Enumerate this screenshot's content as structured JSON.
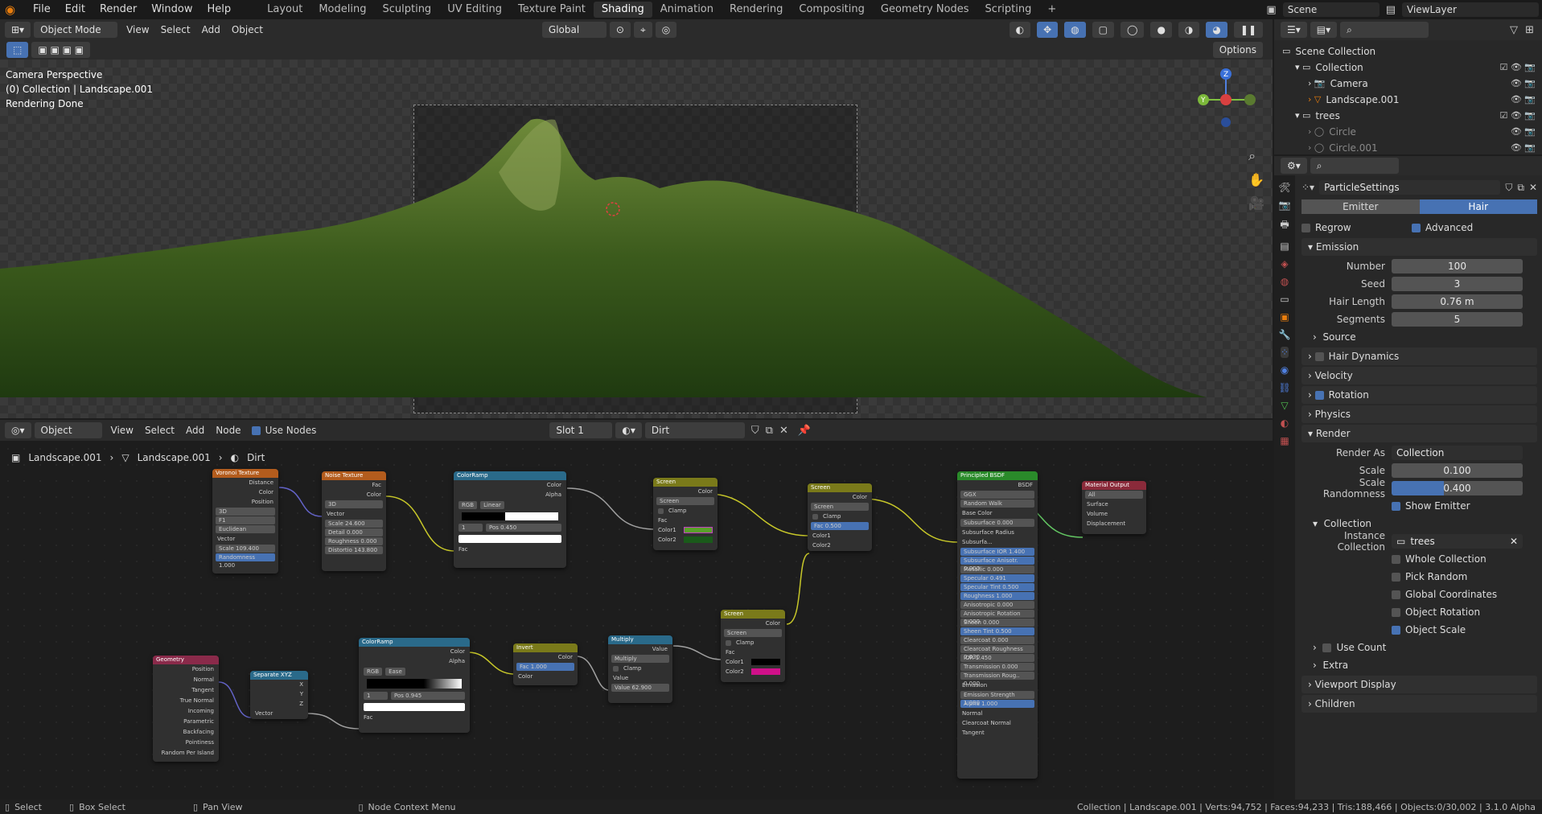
{
  "topbar": {
    "menus": [
      "File",
      "Edit",
      "Render",
      "Window",
      "Help"
    ],
    "workspaces": [
      "Layout",
      "Modeling",
      "Sculpting",
      "UV Editing",
      "Texture Paint",
      "Shading",
      "Animation",
      "Rendering",
      "Compositing",
      "Geometry Nodes",
      "Scripting"
    ],
    "active_workspace": "Shading",
    "scene": "Scene",
    "view_layer": "ViewLayer"
  },
  "viewport": {
    "mode": "Object Mode",
    "menus": [
      "View",
      "Select",
      "Add",
      "Object"
    ],
    "transform": "Global",
    "options": "Options",
    "info": [
      "Camera Perspective",
      "(0) Collection | Landscape.001",
      "Rendering Done"
    ]
  },
  "node_editor": {
    "type": "Object",
    "menus": [
      "View",
      "Select",
      "Add",
      "Node"
    ],
    "use_nodes": "Use Nodes",
    "slot": "Slot 1",
    "material": "Dirt",
    "breadcrumb": [
      "Landscape.001",
      "Landscape.001",
      "Dirt"
    ],
    "nodes": {
      "voronoi": {
        "title": "Voronoi Texture",
        "out": [
          "Distance",
          "Color",
          "Position"
        ],
        "dim": "3D",
        "feature": "F1",
        "metric": "Euclidean",
        "in": "Vector",
        "scale": "Scale   109.400",
        "random": "Randomness  1.000"
      },
      "noise": {
        "title": "Noise Texture",
        "out": [
          "Fac",
          "Color"
        ],
        "dim": "3D",
        "in": "Vector",
        "scale": "Scale   24.600",
        "detail": "Detail   0.000",
        "rough": "Roughness   0.000",
        "distort": "Distortio 143.800"
      },
      "ramp1": {
        "title": "ColorRamp",
        "out": [
          "Color",
          "Alpha"
        ],
        "mode": "RGB",
        "interp": "Linear",
        "idx": "1",
        "pos": "Pos   0.450",
        "in": "Fac"
      },
      "screen1": {
        "title": "Screen",
        "out": "Color",
        "blend": "Screen",
        "clamp": "Clamp",
        "in": [
          "Fac",
          "Color1",
          "Color2"
        ]
      },
      "screen2": {
        "title": "Screen",
        "out": "Color",
        "blend": "Screen",
        "clamp": "Clamp",
        "fac": "Fac  0.500",
        "in": [
          "Color1",
          "Color2"
        ]
      },
      "bsdf": {
        "title": "Principled BSDF",
        "out": "BSDF",
        "dist": "GGX",
        "sss": "Random Walk",
        "rows": [
          "Base Color",
          "Subsurface  0.000",
          "Subsurface Radius",
          "Subsurfa...",
          "Subsurface IOR  1.400",
          "Subsurface Anisotr. 0.000",
          "Metallic  0.000",
          "Specular  0.491",
          "Specular Tint  0.500",
          "Roughness  1.000",
          "Anisotropic  0.000",
          "Anisotropic Rotation 0.000",
          "Sheen  0.000",
          "Sheen Tint  0.500",
          "Clearcoat  0.000",
          "Clearcoat Roughness 0.030",
          "IOR  1.450",
          "Transmission  0.000",
          "Transmission Roug.. 0.000",
          "Emission",
          "Emission Strength 1.000",
          "Alpha  1.000",
          "Normal",
          "Clearcoat Normal",
          "Tangent"
        ]
      },
      "output": {
        "title": "Material Output",
        "target": "All",
        "in": [
          "Surface",
          "Volume",
          "Displacement"
        ]
      },
      "geometry": {
        "title": "Geometry",
        "out": [
          "Position",
          "Normal",
          "Tangent",
          "True Normal",
          "Incoming",
          "Parametric",
          "Backfacing",
          "Pointiness",
          "Random Per Island"
        ]
      },
      "sepxyz": {
        "title": "Separate XYZ",
        "out": [
          "X",
          "Y",
          "Z"
        ],
        "in": "Vector"
      },
      "ramp2": {
        "title": "ColorRamp",
        "out": [
          "Color",
          "Alpha"
        ],
        "mode": "RGB",
        "interp": "Ease",
        "idx": "1",
        "pos": "Pos   0.945",
        "in": "Fac"
      },
      "invert": {
        "title": "Invert",
        "out": "Color",
        "fac": "Fac  1.000",
        "in": "Color"
      },
      "multiply": {
        "title": "Multiply",
        "out": "Value",
        "op": "Multiply",
        "clamp": "Clamp",
        "in": "Value",
        "val": "Value   62.900"
      },
      "screen3": {
        "title": "Screen",
        "out": "Color",
        "blend": "Screen",
        "clamp": "Clamp",
        "in": [
          "Fac",
          "Color1",
          "Color2"
        ]
      }
    }
  },
  "outliner": {
    "items": [
      {
        "label": "Scene Collection",
        "indent": 0
      },
      {
        "label": "Collection",
        "indent": 1
      },
      {
        "label": "Camera",
        "indent": 2
      },
      {
        "label": "Landscape.001",
        "indent": 2
      },
      {
        "label": "trees",
        "indent": 1
      },
      {
        "label": "Circle",
        "indent": 2
      },
      {
        "label": "Circle.001",
        "indent": 2
      }
    ]
  },
  "properties": {
    "datablock": "ParticleSettings",
    "type_emitter": "Emitter",
    "type_hair": "Hair",
    "regrow": "Regrow",
    "advanced": "Advanced",
    "emission": "Emission",
    "number_lbl": "Number",
    "number": "100",
    "seed_lbl": "Seed",
    "seed": "3",
    "hair_len_lbl": "Hair Length",
    "hair_len": "0.76 m",
    "segments_lbl": "Segments",
    "segments": "5",
    "source": "Source",
    "hair_dyn": "Hair Dynamics",
    "velocity": "Velocity",
    "rotation": "Rotation",
    "physics": "Physics",
    "render": "Render",
    "render_as_lbl": "Render As",
    "render_as": "Collection",
    "scale_lbl": "Scale",
    "scale": "0.100",
    "scale_rand_lbl": "Scale Randomness",
    "scale_rand": "0.400",
    "scale_rand_fraction": 0.4,
    "show_emitter": "Show Emitter",
    "collection": "Collection",
    "inst_coll_lbl": "Instance Collection",
    "inst_coll": "trees",
    "whole_coll": "Whole Collection",
    "pick_random": "Pick Random",
    "global_coords": "Global Coordinates",
    "obj_rotation": "Object Rotation",
    "obj_scale": "Object Scale",
    "use_count": "Use Count",
    "extra": "Extra",
    "viewport_display": "Viewport Display",
    "children": "Children"
  },
  "status": {
    "select": "Select",
    "box_select": "Box Select",
    "pan_view": "Pan View",
    "ctx_menu": "Node Context Menu",
    "stats": "Collection | Landscape.001 | Verts:94,752 | Faces:94,233 | Tris:188,466 | Objects:0/30,002 | 3.1.0 Alpha"
  },
  "colors": {
    "accent": "#4772b3",
    "active_orange": "#e87d0d",
    "panel": "#282828"
  }
}
